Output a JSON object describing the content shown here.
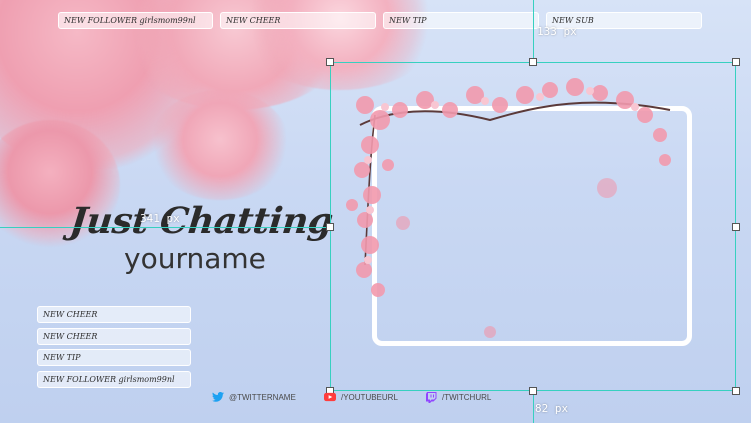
{
  "top_alerts": [
    {
      "label": "NEW FOLLOWER  girlsmom99nl"
    },
    {
      "label": "NEW CHEER"
    },
    {
      "label": "NEW TIP"
    },
    {
      "label": "NEW SUB"
    }
  ],
  "side_alerts": [
    {
      "label": "NEW CHEER"
    },
    {
      "label": "NEW CHEER"
    },
    {
      "label": "NEW TIP"
    },
    {
      "label": "NEW FOLLOWER  girlsmom99nl"
    }
  ],
  "title": {
    "main": "Just Chatting",
    "sub": "yourname"
  },
  "measurements": {
    "top": "133 px",
    "left": "341 px",
    "bottom": "82 px"
  },
  "socials": [
    {
      "icon": "twitter-icon",
      "label": "@TWITTERNAME",
      "color": "#1da1f2"
    },
    {
      "icon": "youtube-icon",
      "label": "/YOUTUBEURL",
      "color": "#ff3d3d"
    },
    {
      "icon": "twitch-icon",
      "label": "/TWITCHURL",
      "color": "#9146ff"
    }
  ],
  "colors": {
    "guide": "#37d0c0",
    "blossom": "#f2a3b3",
    "frame": "#ffffff"
  }
}
